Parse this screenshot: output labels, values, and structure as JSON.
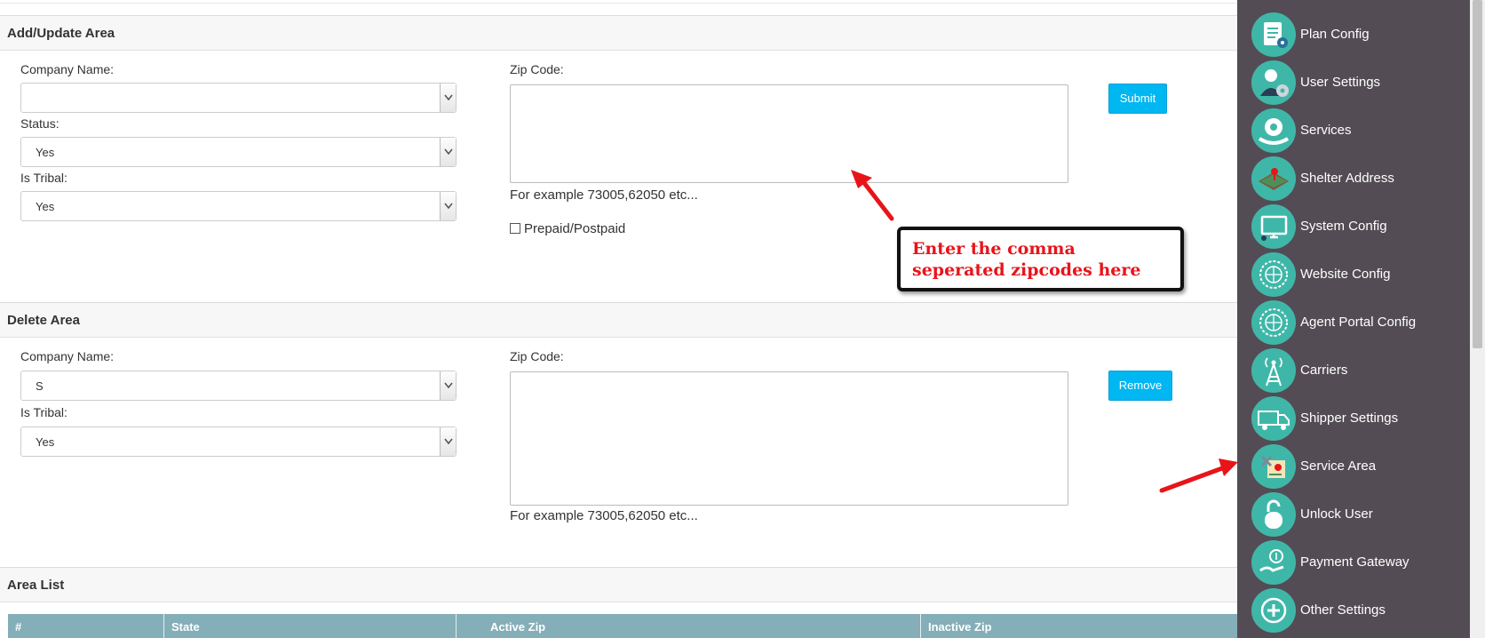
{
  "add_area": {
    "title": "Add/Update Area",
    "company_label": "Company Name:",
    "company_value": "",
    "status_label": "Status:",
    "status_value": "Yes",
    "tribal_label": "Is Tribal:",
    "tribal_value": "Yes",
    "zip_label": "Zip Code:",
    "zip_value": "",
    "zip_hint": "For example 73005,62050 etc...",
    "prepaid_label": "Prepaid/Postpaid",
    "submit_label": "Submit"
  },
  "callout": {
    "line1": "Enter the comma",
    "line2": "seperated zipcodes here"
  },
  "delete_area": {
    "title": "Delete Area",
    "company_label": "Company Name:",
    "company_value": "S",
    "tribal_label": "Is Tribal:",
    "tribal_value": "Yes",
    "zip_label": "Zip Code:",
    "zip_value": "",
    "zip_hint": "For example 73005,62050 etc...",
    "remove_label": "Remove"
  },
  "area_list": {
    "title": "Area List",
    "columns": [
      "#",
      "State",
      "Active Zip",
      "Inactive Zip"
    ]
  },
  "sidebar": {
    "items": [
      {
        "label": "Plan Config",
        "icon": "plan-config-icon"
      },
      {
        "label": "User Settings",
        "icon": "user-settings-icon"
      },
      {
        "label": "Services",
        "icon": "services-icon"
      },
      {
        "label": "Shelter Address",
        "icon": "map-icon"
      },
      {
        "label": "System Config",
        "icon": "monitor-icon"
      },
      {
        "label": "Website Config",
        "icon": "globe-gear-icon"
      },
      {
        "label": "Agent Portal Config",
        "icon": "globe-gear-icon"
      },
      {
        "label": "Carriers",
        "icon": "antenna-tower-icon"
      },
      {
        "label": "Shipper Settings",
        "icon": "truck-icon"
      },
      {
        "label": "Service Area",
        "icon": "service-area-icon"
      },
      {
        "label": "Unlock User",
        "icon": "padlock-icon"
      },
      {
        "label": "Payment Gateway",
        "icon": "payment-icon"
      },
      {
        "label": "Other Settings",
        "icon": "plus-icon"
      }
    ]
  },
  "colors": {
    "sidebar_bg": "#544c55",
    "icon_circle": "#3fb7a8",
    "button": "#00b7f1",
    "table_head": "#84aeb8",
    "callout_text": "#e8141a",
    "arrow": "#e8141a"
  }
}
